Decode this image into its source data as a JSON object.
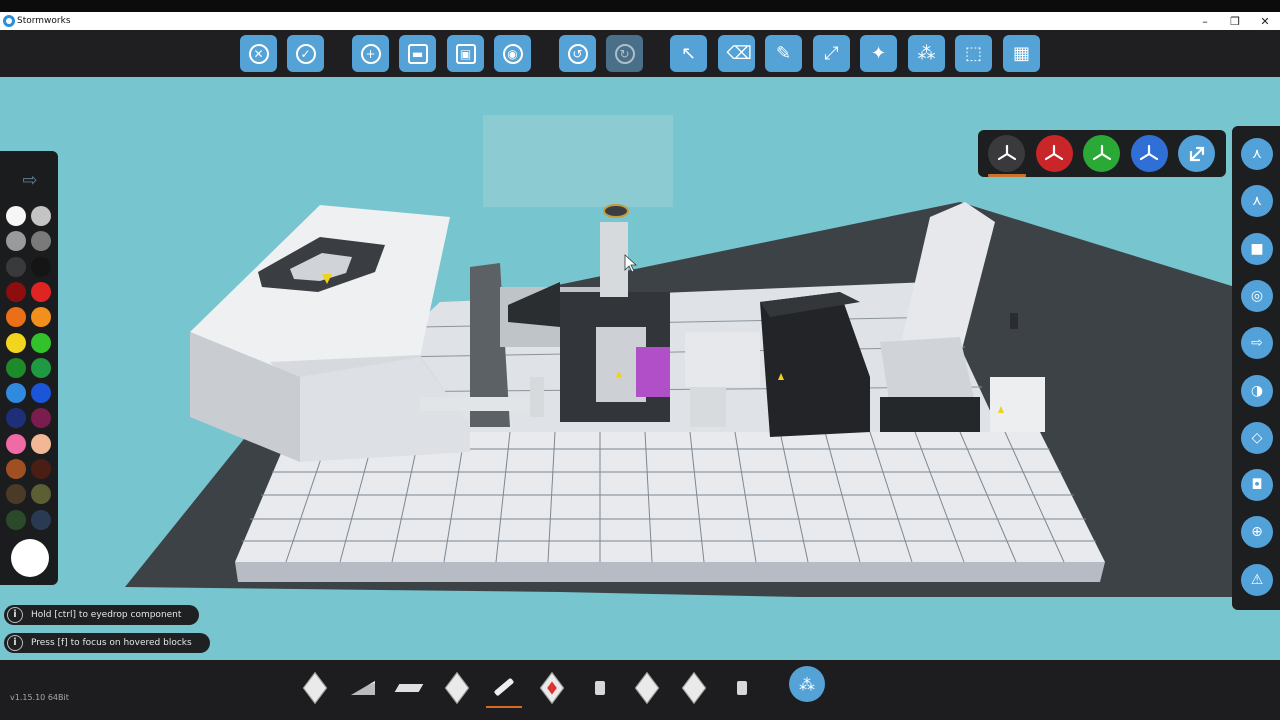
{
  "window": {
    "title": "Stormworks",
    "controls": [
      "minimize-icon",
      "restore-icon",
      "close-icon"
    ]
  },
  "toolbar": {
    "buttons": [
      {
        "icon": "close-icon",
        "glyph": "✕"
      },
      {
        "icon": "check-icon",
        "glyph": "✓"
      },
      {
        "icon": "new-icon",
        "glyph": "+"
      },
      {
        "icon": "folder-icon",
        "glyph": "▬"
      },
      {
        "icon": "save-icon",
        "glyph": "▣"
      },
      {
        "icon": "steam-icon",
        "glyph": "◉"
      },
      {
        "icon": "undo-icon",
        "glyph": "↺"
      },
      {
        "icon": "redo-icon",
        "glyph": "↻"
      },
      {
        "icon": "select-cursor-icon",
        "glyph": "↖"
      },
      {
        "icon": "eraser-icon",
        "glyph": "⌫"
      },
      {
        "icon": "paint-brush-icon",
        "glyph": "✎"
      },
      {
        "icon": "transform-icon",
        "glyph": "⤢"
      },
      {
        "icon": "lightbulb-icon",
        "glyph": "✦"
      },
      {
        "icon": "logic-icon",
        "glyph": "⁂"
      },
      {
        "icon": "selection-box-icon",
        "glyph": "⬚"
      },
      {
        "icon": "microcontroller-icon",
        "glyph": "▦"
      }
    ]
  },
  "palette": {
    "arrow_icon": "arrow-right-icon",
    "colors": [
      [
        "#f6f6f6",
        "#c4c4c4"
      ],
      [
        "#9a9a9a",
        "#7a7a7a"
      ],
      [
        "#3a3a3a",
        "#151515"
      ],
      [
        "#8c0e0e",
        "#e02424"
      ],
      [
        "#ea6f18",
        "#f2901c"
      ],
      [
        "#f2d51e",
        "#32c22a"
      ],
      [
        "#1d8b2a",
        "#1f9a42"
      ],
      [
        "#2f8ae0",
        "#1b55d8"
      ],
      [
        "#1e2f7a",
        "#7a1c4e"
      ],
      [
        "#f06aa6",
        "#f2b896"
      ],
      [
        "#a04f22",
        "#4a1e14"
      ],
      [
        "#4a3a26",
        "#5c5e34"
      ],
      [
        "#2a4a2a",
        "#2a3a52"
      ]
    ],
    "selected_color": "#ffffff"
  },
  "hints": [
    {
      "icon": "info-icon",
      "text": "Hold [ctrl] to eyedrop component"
    },
    {
      "icon": "info-icon",
      "text": "Press [f] to focus on hovered blocks"
    }
  ],
  "view_panel": {
    "buttons": [
      {
        "icon": "axis-view-neutral-icon",
        "color": "#3a3a3c"
      },
      {
        "icon": "axis-view-x-icon",
        "color": "#c9262a"
      },
      {
        "icon": "axis-view-y-icon",
        "color": "#2aa936"
      },
      {
        "icon": "axis-view-z-icon",
        "color": "#2f6fd6"
      },
      {
        "icon": "expand-view-icon",
        "color": "#52a1d8"
      }
    ]
  },
  "right_bar": {
    "buttons": [
      "axis-gizmo-icon",
      "axis-gizmo-alt-icon",
      "camera-icon",
      "target-icon",
      "arrow-forward-icon",
      "rotate-view-icon",
      "cube-outline-icon",
      "camera-settings-icon",
      "vehicle-icon",
      "warning-icon"
    ]
  },
  "bottom_bar": {
    "version": "v1.15.10 64Bit",
    "items": [
      "block-cube-icon",
      "wedge-block-icon",
      "flat-plate-icon",
      "pyramid-block-icon",
      "pen-tool-icon",
      "red-block-icon",
      "small-part-icon",
      "cube-icon-2",
      "cube-icon-3",
      "piston-icon"
    ],
    "logic_button_icon": "logic-nodes-icon"
  }
}
